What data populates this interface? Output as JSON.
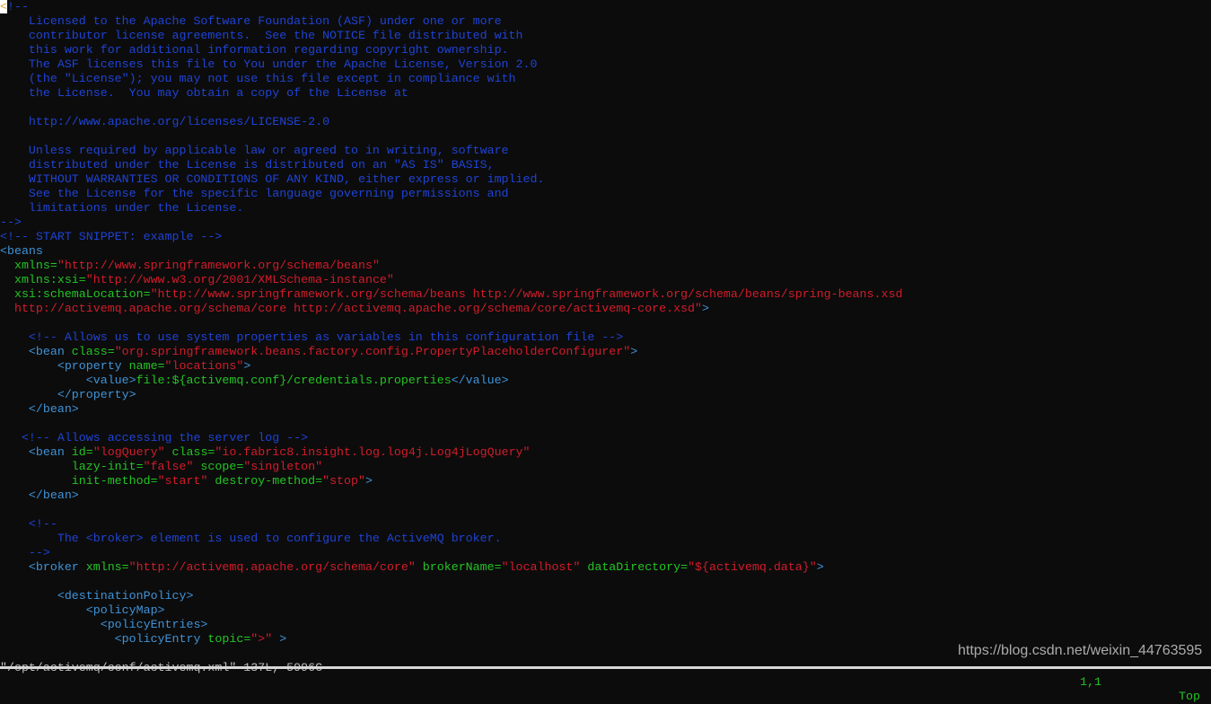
{
  "colors": {
    "background": "#0c0c0c",
    "comment": "#1f43d6",
    "tag": "#3f93d8",
    "attribute": "#23c523",
    "string": "#d21c2a",
    "cursor": "#ffffff"
  },
  "lines": [
    [
      [
        "cursor",
        "<"
      ],
      [
        "cm",
        "!--"
      ]
    ],
    [
      [
        "cm",
        "    Licensed to the Apache Software Foundation (ASF) under one or more"
      ]
    ],
    [
      [
        "cm",
        "    contributor license agreements.  See the NOTICE file distributed with"
      ]
    ],
    [
      [
        "cm",
        "    this work for additional information regarding copyright ownership."
      ]
    ],
    [
      [
        "cm",
        "    The ASF licenses this file to You under the Apache License, Version 2.0"
      ]
    ],
    [
      [
        "cm",
        "    (the \"License\"); you may not use this file except in compliance with"
      ]
    ],
    [
      [
        "cm",
        "    the License.  You may obtain a copy of the License at"
      ]
    ],
    [],
    [
      [
        "cm",
        "    http://www.apache.org/licenses/LICENSE-2.0"
      ]
    ],
    [],
    [
      [
        "cm",
        "    Unless required by applicable law or agreed to in writing, software"
      ]
    ],
    [
      [
        "cm",
        "    distributed under the License is distributed on an \"AS IS\" BASIS,"
      ]
    ],
    [
      [
        "cm",
        "    WITHOUT WARRANTIES OR CONDITIONS OF ANY KIND, either express or implied."
      ]
    ],
    [
      [
        "cm",
        "    See the License for the specific language governing permissions and"
      ]
    ],
    [
      [
        "cm",
        "    limitations under the License."
      ]
    ],
    [
      [
        "cm",
        "-->"
      ]
    ],
    [
      [
        "cm",
        "<!-- START SNIPPET: example -->"
      ]
    ],
    [
      [
        "tg",
        "<beans"
      ]
    ],
    [
      [
        "at",
        "  xmlns="
      ],
      [
        "st",
        "\"http://www.springframework.org/schema/beans\""
      ]
    ],
    [
      [
        "at",
        "  xmlns:xsi="
      ],
      [
        "st",
        "\"http://www.w3.org/2001/XMLSchema-instance\""
      ]
    ],
    [
      [
        "at",
        "  xsi:schemaLocation="
      ],
      [
        "st",
        "\"http://www.springframework.org/schema/beans http://www.springframework.org/schema/beans/spring-beans.xsd"
      ]
    ],
    [
      [
        "st",
        "  http://activemq.apache.org/schema/core http://activemq.apache.org/schema/core/activemq-core.xsd\""
      ],
      [
        "tg",
        ">"
      ]
    ],
    [],
    [
      [
        "cm",
        "    <!-- Allows us to use system properties as variables in this configuration file -->"
      ]
    ],
    [
      [
        "tg",
        "    <bean"
      ],
      [
        "at",
        " class="
      ],
      [
        "st",
        "\"org.springframework.beans.factory.config.PropertyPlaceholderConfigurer\""
      ],
      [
        "tg",
        ">"
      ]
    ],
    [
      [
        "tg",
        "        <property"
      ],
      [
        "at",
        " name="
      ],
      [
        "st",
        "\"locations\""
      ],
      [
        "tg",
        ">"
      ]
    ],
    [
      [
        "tg",
        "            <value>"
      ],
      [
        "at",
        "file:${activemq.conf}/credentials.properties"
      ],
      [
        "tg",
        "</value>"
      ]
    ],
    [
      [
        "tg",
        "        </property>"
      ]
    ],
    [
      [
        "tg",
        "    </bean>"
      ]
    ],
    [],
    [
      [
        "cm",
        "   <!-- Allows accessing the server log -->"
      ]
    ],
    [
      [
        "tg",
        "    <bean"
      ],
      [
        "at",
        " id="
      ],
      [
        "st",
        "\"logQuery\""
      ],
      [
        "at",
        " class="
      ],
      [
        "st",
        "\"io.fabric8.insight.log.log4j.Log4jLogQuery\""
      ]
    ],
    [
      [
        "at",
        "          lazy-init="
      ],
      [
        "st",
        "\"false\""
      ],
      [
        "at",
        " scope="
      ],
      [
        "st",
        "\"singleton\""
      ]
    ],
    [
      [
        "at",
        "          init-method="
      ],
      [
        "st",
        "\"start\""
      ],
      [
        "at",
        " destroy-method="
      ],
      [
        "st",
        "\"stop\""
      ],
      [
        "tg",
        ">"
      ]
    ],
    [
      [
        "tg",
        "    </bean>"
      ]
    ],
    [],
    [
      [
        "cm",
        "    <!--"
      ]
    ],
    [
      [
        "cm",
        "        The <broker> element is used to configure the ActiveMQ broker."
      ]
    ],
    [
      [
        "cm",
        "    -->"
      ]
    ],
    [
      [
        "tg",
        "    <broker"
      ],
      [
        "at",
        " xmlns="
      ],
      [
        "st",
        "\"http://activemq.apache.org/schema/core\""
      ],
      [
        "at",
        " brokerName="
      ],
      [
        "st",
        "\"localhost\""
      ],
      [
        "at",
        " dataDirectory="
      ],
      [
        "st",
        "\"${activemq.data}\""
      ],
      [
        "tg",
        ">"
      ]
    ],
    [],
    [
      [
        "tg",
        "        <destinationPolicy>"
      ]
    ],
    [
      [
        "tg",
        "            <policyMap>"
      ]
    ],
    [
      [
        "tg",
        "              <policyEntries>"
      ]
    ],
    [
      [
        "tg",
        "                <policyEntry"
      ],
      [
        "at",
        " topic="
      ],
      [
        "st",
        "\">\""
      ],
      [
        "tg",
        " >"
      ]
    ]
  ],
  "status": {
    "message": "\"/opt/activemq/conf/activemq.xml\" 137L, 5996C",
    "position": "1,1",
    "scroll": "Top"
  },
  "watermark": "https://blog.csdn.net/weixin_44763595"
}
